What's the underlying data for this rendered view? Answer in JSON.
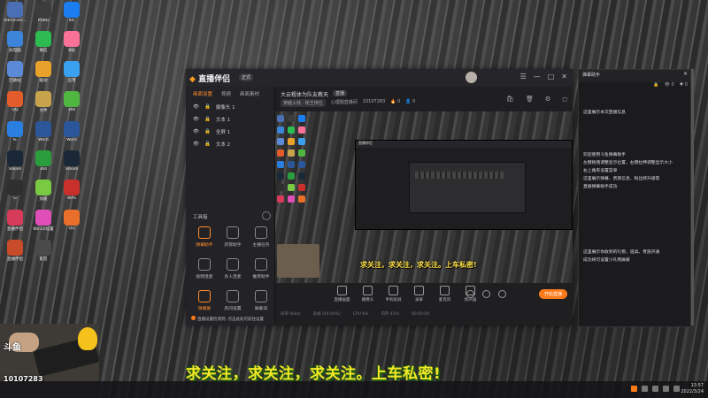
{
  "desktop": {
    "icons": [
      {
        "label": "Administr...",
        "color": "#4a6fb5"
      },
      {
        "label": "PUBG",
        "color": "#3c3c3c"
      },
      {
        "label": "KK",
        "color": "#1a7df0"
      },
      {
        "label": "此电脑",
        "color": "#3b84d8"
      },
      {
        "label": "微信",
        "color": "#2dbb52"
      },
      {
        "label": "B站",
        "color": "#fb7299"
      },
      {
        "label": "回收站",
        "color": "#5b8ad6"
      },
      {
        "label": "驱动",
        "color": "#e8a22c"
      },
      {
        "label": "应用",
        "color": "#3aa0f0"
      },
      {
        "label": "QQ",
        "color": "#e35c2c"
      },
      {
        "label": "文件",
        "color": "#c7a44c"
      },
      {
        "label": "360",
        "color": "#4fb640"
      },
      {
        "label": "IE",
        "color": "#2b7fe0"
      },
      {
        "label": "Word",
        "color": "#2b579a"
      },
      {
        "label": "Word",
        "color": "#2b579a"
      },
      {
        "label": "Steam",
        "color": "#1b2838"
      },
      {
        "label": "360",
        "color": "#2a9d3c"
      },
      {
        "label": "Steam",
        "color": "#1b2838"
      },
      {
        "label": "G",
        "color": "#2f2f2f"
      },
      {
        "label": "加速",
        "color": "#7ac943"
      },
      {
        "label": "WPS",
        "color": "#c9302c"
      },
      {
        "label": "直播伴侣",
        "color": "#d63b5a"
      },
      {
        "label": "Win10设置",
        "color": "#e04fb8"
      },
      {
        "label": "QQ",
        "color": "#e8702a"
      },
      {
        "label": "直播伴侣",
        "color": "#c84b2a"
      },
      {
        "label": "影音",
        "color": "#4a4a4a"
      }
    ]
  },
  "app": {
    "logo_main": "直播伴侣",
    "beta": "正式",
    "winctl": [
      "☰",
      "—",
      "□",
      "✕"
    ],
    "left_tabs": [
      "画面设置",
      "视频",
      "画面素材"
    ],
    "sources": [
      {
        "label": "摄像头 1"
      },
      {
        "label": "文本 1"
      },
      {
        "label": "全屏 1"
      },
      {
        "label": "文本 2"
      }
    ],
    "tools_label": "工具箱",
    "tools": [
      {
        "label": "弹幕助手",
        "on": true
      },
      {
        "label": "房管助手",
        "on": false
      },
      {
        "label": "主播任务",
        "on": false
      },
      {
        "label": "视频连麦",
        "on": false
      },
      {
        "label": "多人连麦",
        "on": false
      },
      {
        "label": "推荐助手",
        "on": false
      },
      {
        "label": "弹幕屏",
        "on": true
      },
      {
        "label": "房间设置",
        "on": false
      },
      {
        "label": "屏蔽词",
        "on": false
      }
    ],
    "room_title": "大云粗体为队友教天",
    "room_tag": "直播",
    "chips": [
      "穿越火线 · 枪王排位",
      "心理题直播间",
      "10107283"
    ],
    "likes": "0",
    "viewers": "0",
    "header_icons": [
      "🛍",
      "🗑",
      "⚙",
      "◻"
    ],
    "preview_subtitle": "求关注，求关注，求关注。上车私密!",
    "controls": [
      {
        "label": "直播画面"
      },
      {
        "label": "摄像头"
      },
      {
        "label": "手机投屏"
      },
      {
        "label": "录屏"
      },
      {
        "label": "麦克风"
      },
      {
        "label": "扬声器"
      }
    ],
    "live_button": "开始直播",
    "stats": [
      "码率 0kb/s",
      "丢帧 0(0.00%)",
      "CPU 6%",
      "内存 45%",
      "00:00:00"
    ],
    "notice": "直播设置检测到: 点击此处可前往设置"
  },
  "assistant": {
    "title": "弹幕助手",
    "tools": [
      "🔒",
      "👁 0",
      "♥ 0"
    ],
    "line1": "这里展示本次直播信息",
    "block2": [
      "欢迎使用斗鱼弹幕助手",
      "左键拖拽调整显示位置，右键拉伸调整显示大小",
      "右上角有设置菜单",
      "这里展示弹幕、贵族信息、粉丝牌升级等",
      "直播弹幕助手成功"
    ],
    "block3": [
      "这里展示你收到的礼物、道具、贵族开通",
      "成功将可设置小礼物屏蔽"
    ]
  },
  "stream": {
    "platform": "斗鱼",
    "room_id": "10107283"
  },
  "overlay_subtitle": "求关注，求关注，求关注。上车私密!",
  "taskbar": {
    "time": "13:57",
    "date": "2022/3/24"
  }
}
